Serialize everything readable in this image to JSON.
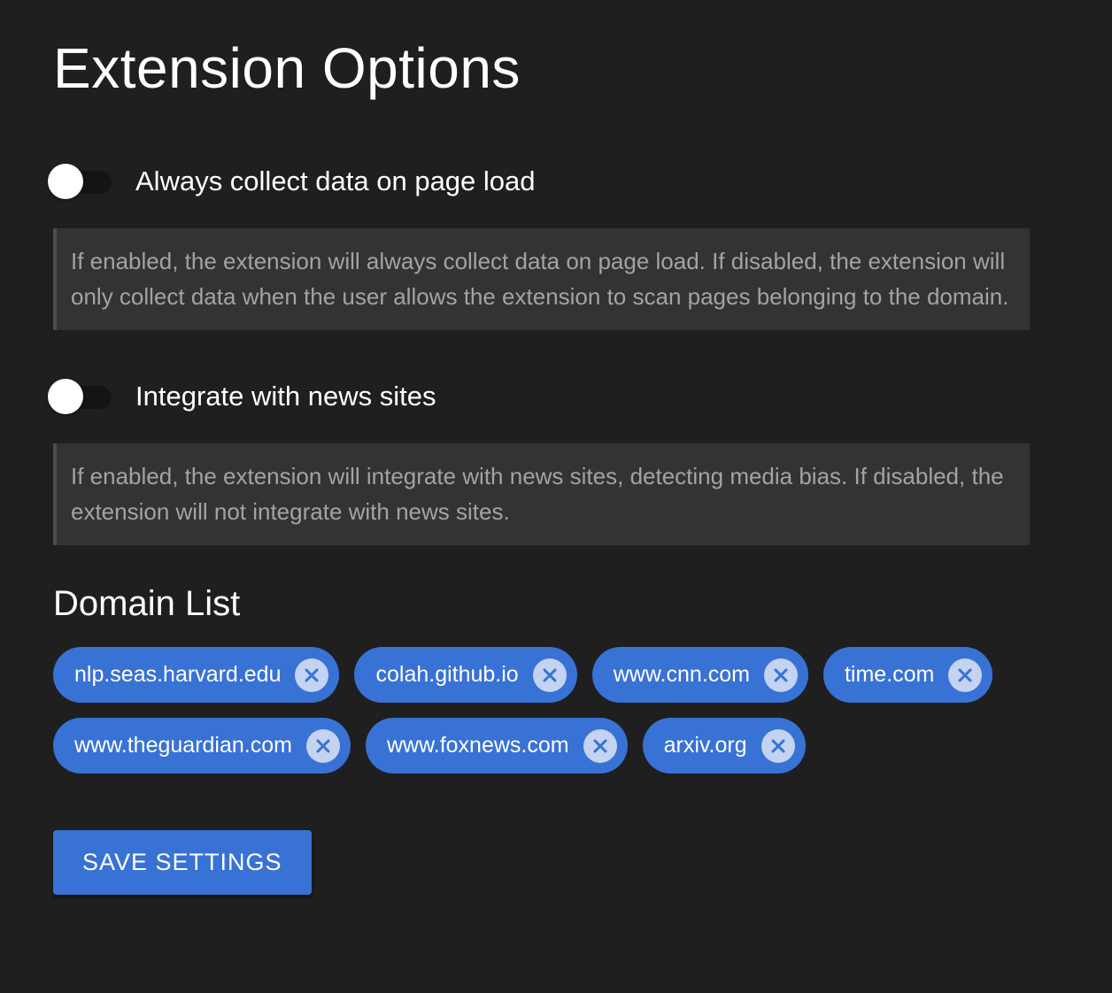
{
  "page": {
    "title": "Extension Options"
  },
  "settings": {
    "collect_on_load": {
      "label": "Always collect data on page load",
      "enabled": false,
      "description": "If enabled, the extension will always collect data on page load. If disabled, the extension will only collect data when the user allows the extension to scan pages belonging to the domain."
    },
    "news_integration": {
      "label": "Integrate with news sites",
      "enabled": false,
      "description": "If enabled, the extension will integrate with news sites, detecting media bias. If disabled, the extension will not integrate with news sites."
    }
  },
  "domain_list": {
    "heading": "Domain List",
    "remove_icon": "close-circle-icon",
    "domains": [
      "nlp.seas.harvard.edu",
      "colah.github.io",
      "www.cnn.com",
      "time.com",
      "www.theguardian.com",
      "www.foxnews.com",
      "arxiv.org"
    ]
  },
  "actions": {
    "save_label": "SAVE SETTINGS"
  },
  "colors": {
    "background": "#1f1f1f",
    "accent": "#3872d4",
    "description_bg": "#333333",
    "description_text": "#a3a3a3",
    "chip_remove_bg": "#c3d3f1"
  }
}
